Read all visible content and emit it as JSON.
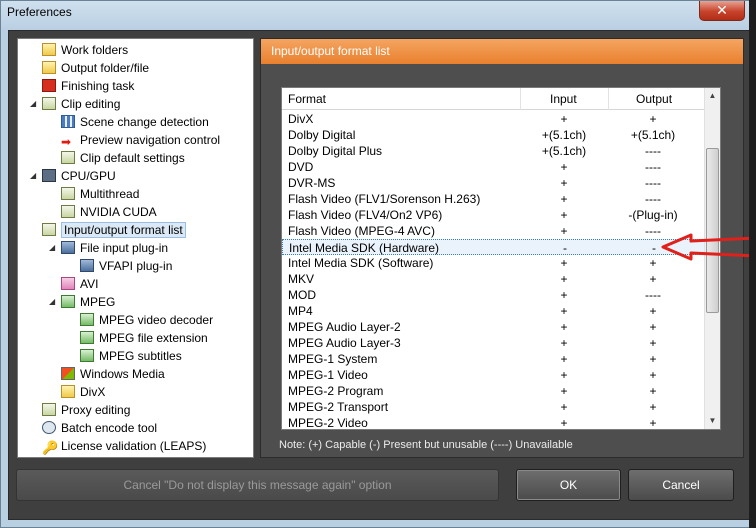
{
  "window": {
    "title": "Preferences",
    "close_icon": "close-icon"
  },
  "tree": {
    "items": [
      {
        "label": "Work folders",
        "icon": "folder-icon",
        "level": 1,
        "expander": ""
      },
      {
        "label": "Output folder/file",
        "icon": "folder-icon",
        "level": 1,
        "expander": ""
      },
      {
        "label": "Finishing task",
        "icon": "finishing-icon",
        "level": 1,
        "expander": ""
      },
      {
        "label": "Clip editing",
        "icon": "clip-editing-icon",
        "level": 1,
        "expander": "◢"
      },
      {
        "label": "Scene change detection",
        "icon": "scene-icon",
        "level": 2,
        "expander": ""
      },
      {
        "label": "Preview navigation control",
        "icon": "arrow-icon",
        "level": 2,
        "expander": ""
      },
      {
        "label": "Clip default settings",
        "icon": "settings-icon",
        "level": 2,
        "expander": ""
      },
      {
        "label": "CPU/GPU",
        "icon": "cpu-icon",
        "level": 1,
        "expander": "◢"
      },
      {
        "label": "Multithread",
        "icon": "settings-icon",
        "level": 2,
        "expander": ""
      },
      {
        "label": "NVIDIA CUDA",
        "icon": "settings-icon",
        "level": 2,
        "expander": ""
      },
      {
        "label": "Input/output format list",
        "icon": "list-icon",
        "level": 1,
        "expander": "",
        "selected": true
      },
      {
        "label": "File input plug-in",
        "icon": "plugin-icon",
        "level": 2,
        "expander": "◢"
      },
      {
        "label": "VFAPI plug-in",
        "icon": "plugin-icon",
        "level": 3,
        "expander": ""
      },
      {
        "label": "AVI",
        "icon": "avi-icon",
        "level": 2,
        "expander": ""
      },
      {
        "label": "MPEG",
        "icon": "mpeg-icon",
        "level": 2,
        "expander": "◢"
      },
      {
        "label": "MPEG video decoder",
        "icon": "mpeg-sub-icon",
        "level": 3,
        "expander": ""
      },
      {
        "label": "MPEG file extension",
        "icon": "mpeg-sub-icon",
        "level": 3,
        "expander": ""
      },
      {
        "label": "MPEG subtitles",
        "icon": "mpeg-sub-icon",
        "level": 3,
        "expander": ""
      },
      {
        "label": "Windows Media",
        "icon": "windows-media-icon",
        "level": 2,
        "expander": ""
      },
      {
        "label": "DivX",
        "icon": "divx-icon",
        "level": 2,
        "expander": ""
      },
      {
        "label": "Proxy editing",
        "icon": "proxy-icon",
        "level": 1,
        "expander": ""
      },
      {
        "label": "Batch encode tool",
        "icon": "batch-icon",
        "level": 1,
        "expander": ""
      },
      {
        "label": "License validation (LEAPS)",
        "icon": "key-icon",
        "level": 1,
        "expander": ""
      }
    ]
  },
  "panel": {
    "header": "Input/output format list",
    "columns": [
      "Format",
      "Input",
      "Output"
    ],
    "rows": [
      {
        "format": "DivX",
        "input": "+",
        "output": "+"
      },
      {
        "format": "Dolby Digital",
        "input": "+(5.1ch)",
        "output": "+(5.1ch)"
      },
      {
        "format": "Dolby Digital Plus",
        "input": "+(5.1ch)",
        "output": "----"
      },
      {
        "format": "DVD",
        "input": "+",
        "output": "----"
      },
      {
        "format": "DVR-MS",
        "input": "+",
        "output": "----"
      },
      {
        "format": "Flash Video (FLV1/Sorenson H.263)",
        "input": "+",
        "output": "----"
      },
      {
        "format": "Flash Video (FLV4/On2 VP6)",
        "input": "+",
        "output": "-(Plug-in)"
      },
      {
        "format": "Flash Video (MPEG-4 AVC)",
        "input": "+",
        "output": "----"
      },
      {
        "format": "Intel Media SDK (Hardware)",
        "input": "-",
        "output": "-",
        "highlight": true
      },
      {
        "format": "Intel Media SDK (Software)",
        "input": "+",
        "output": "+"
      },
      {
        "format": "MKV",
        "input": "+",
        "output": "+"
      },
      {
        "format": "MOD",
        "input": "+",
        "output": "----"
      },
      {
        "format": "MP4",
        "input": "+",
        "output": "+"
      },
      {
        "format": "MPEG Audio Layer-2",
        "input": "+",
        "output": "+"
      },
      {
        "format": "MPEG Audio Layer-3",
        "input": "+",
        "output": "+"
      },
      {
        "format": "MPEG-1 System",
        "input": "+",
        "output": "+"
      },
      {
        "format": "MPEG-1 Video",
        "input": "+",
        "output": "+"
      },
      {
        "format": "MPEG-2 Program",
        "input": "+",
        "output": "+"
      },
      {
        "format": "MPEG-2 Transport",
        "input": "+",
        "output": "+"
      },
      {
        "format": "MPEG-2 Video",
        "input": "+",
        "output": "+"
      }
    ],
    "note": "Note: (+) Capable   (-) Present but unusable   (----) Unavailable"
  },
  "buttons": {
    "cancel_message": "Cancel \"Do not display this message again\" option",
    "ok": "OK",
    "cancel": "Cancel"
  },
  "colors": {
    "panel_header": "#ec8a37",
    "annotation_arrow": "#e0201a"
  }
}
